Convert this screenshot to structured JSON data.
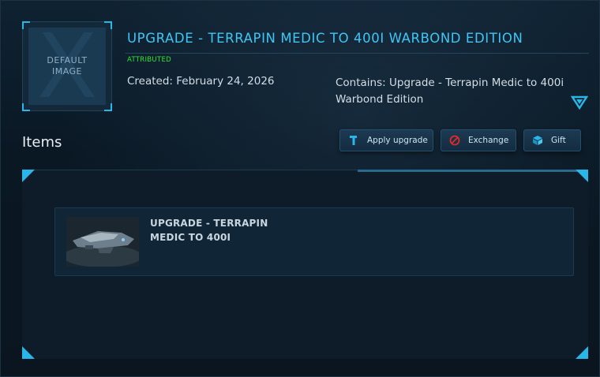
{
  "pledge": {
    "thumbnail_label": "DEFAULT\nIMAGE",
    "title": "UPGRADE - TERRAPIN MEDIC TO 400I WARBOND EDITION",
    "badge": "ATTRIBUTED",
    "created": "Created: February 24, 2026",
    "contains": "Contains: Upgrade - Terrapin Medic to 400i Warbond Edition",
    "expand_icon": "triangle-down-icon"
  },
  "items_section": {
    "heading": "Items",
    "buttons": [
      {
        "label": "Apply upgrade",
        "icon": "wrench-icon"
      },
      {
        "label": "Exchange",
        "icon": "no-entry-icon"
      },
      {
        "label": "Gift",
        "icon": "gift-box-icon"
      }
    ],
    "items": [
      {
        "title": "UPGRADE - TERRAPIN\nMEDIC TO 400I"
      }
    ]
  },
  "colors": {
    "accent": "#29b6e8",
    "title": "#3fc6f5",
    "badge": "#2ee82e",
    "background": "#0b1a26"
  }
}
